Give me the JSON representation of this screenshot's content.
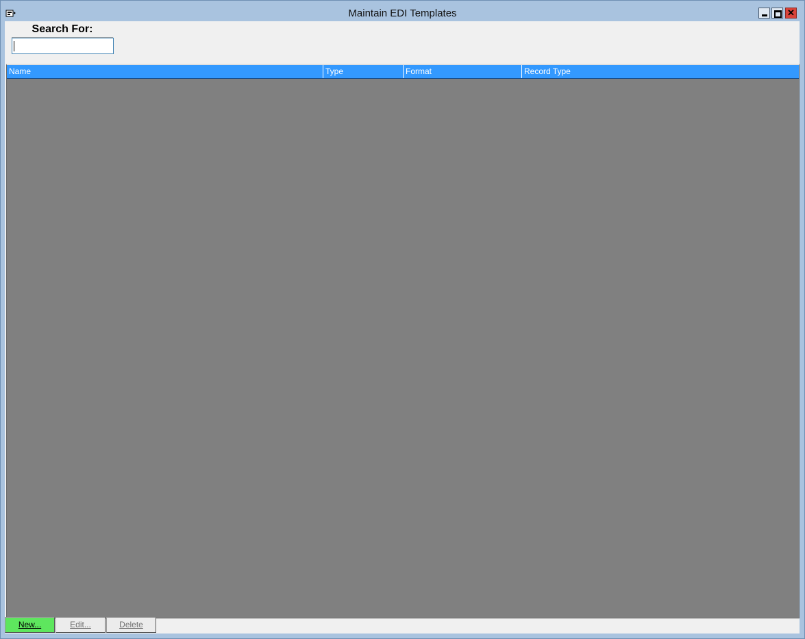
{
  "window": {
    "title": "Maintain EDI Templates",
    "controls": {
      "minimize_icon": "minimize-icon",
      "maximize_icon": "maximize-icon",
      "close_icon": "close-icon",
      "close_glyph": "✕"
    }
  },
  "search": {
    "label": "Search For:",
    "value": ""
  },
  "grid": {
    "columns": [
      "Name",
      "Type",
      "Format",
      "Record Type"
    ],
    "rows": []
  },
  "buttons": {
    "new_label": "New...",
    "edit_label": "Edit...",
    "delete_label": "Delete"
  },
  "colors": {
    "header_bg": "#3399ff",
    "grid_bg": "#808080",
    "new_button_bg": "#5ee65e",
    "frame": "#a9c3df"
  }
}
